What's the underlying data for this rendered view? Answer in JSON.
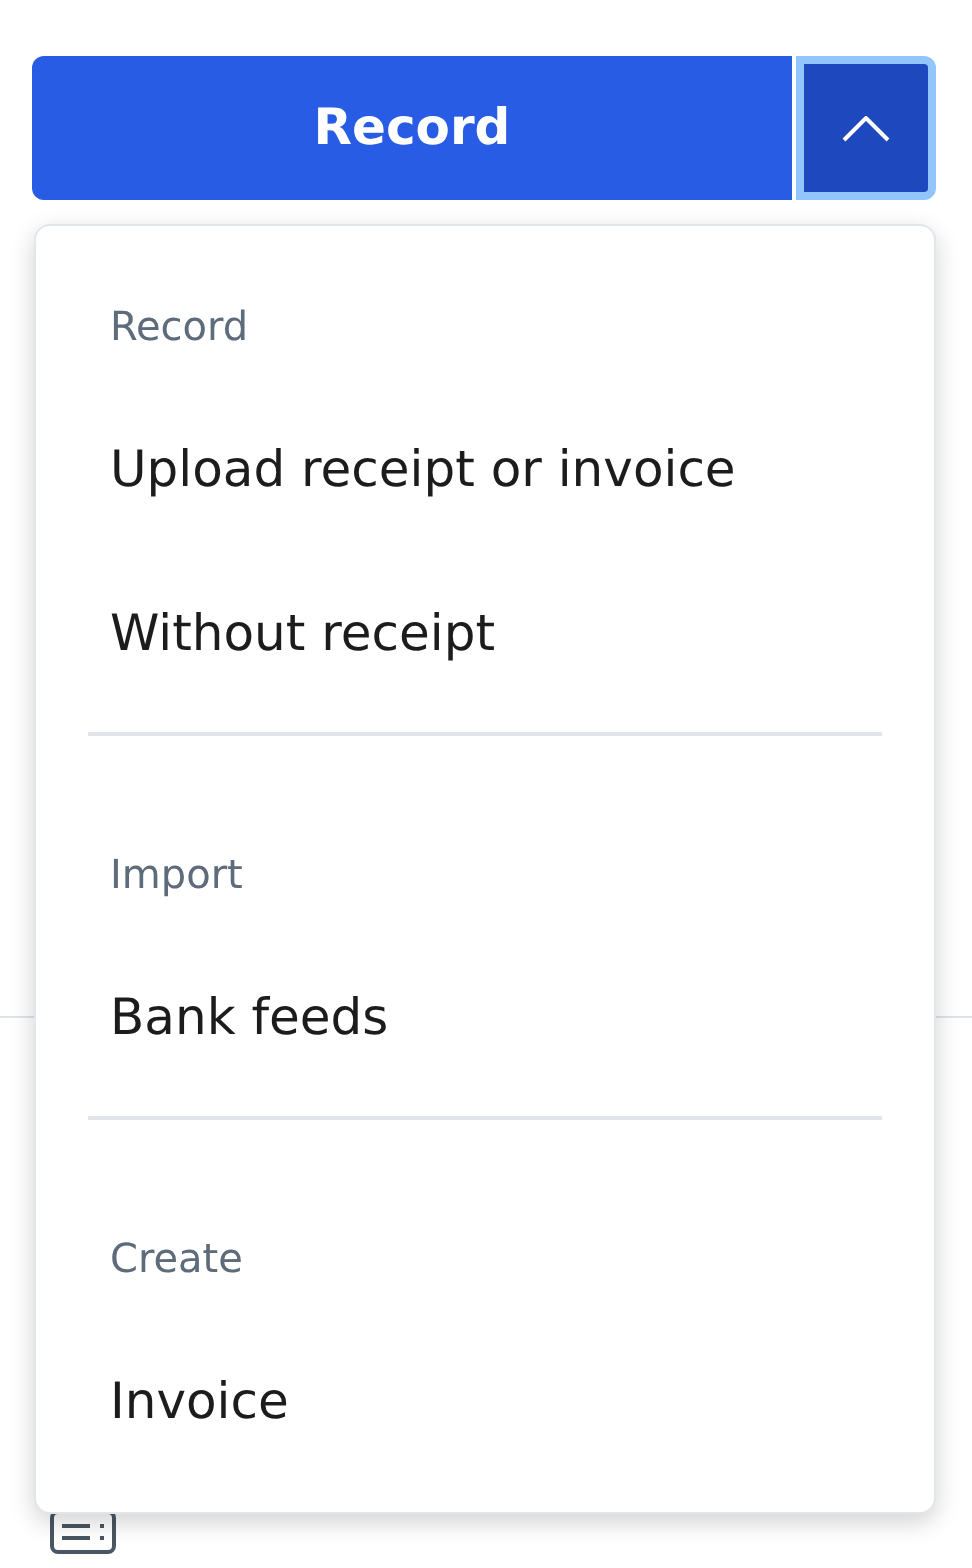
{
  "button": {
    "label": "Record",
    "menu_expanded": true
  },
  "menu": {
    "sections": [
      {
        "header": "Record",
        "items": [
          "Upload receipt or invoice",
          "Without receipt"
        ]
      },
      {
        "header": "Import",
        "items": [
          "Bank feeds"
        ]
      },
      {
        "header": "Create",
        "items": [
          "Invoice"
        ]
      }
    ]
  }
}
